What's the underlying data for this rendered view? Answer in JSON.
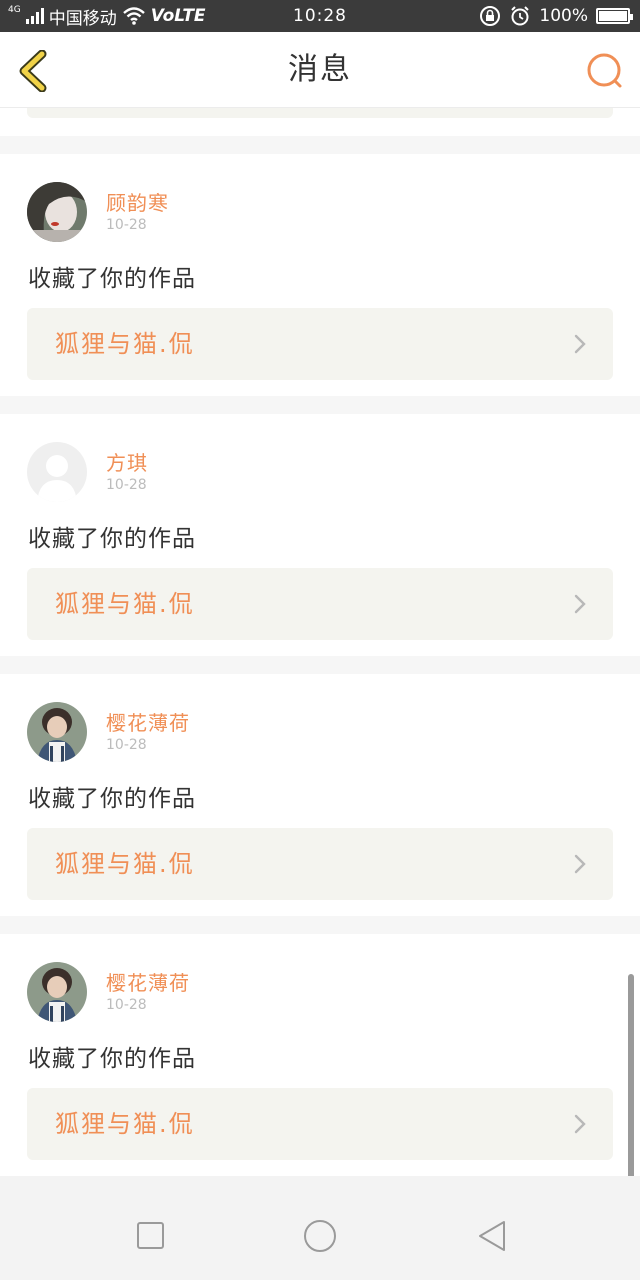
{
  "status_bar": {
    "network": "4G",
    "carrier": "中国移动",
    "volte": "VoLTE",
    "time": "10:28",
    "battery_percent": "100%"
  },
  "nav": {
    "title": "消息",
    "back_icon": "chevron-left-icon",
    "search_icon": "search-icon",
    "accent_color": "#f08f56",
    "back_color": "#f1d348"
  },
  "notifications": [
    {
      "username": "顾韵寒",
      "date": "10-28",
      "action": "收藏了你的作品",
      "work_title": "狐狸与猫.侃"
    },
    {
      "username": "方琪",
      "date": "10-28",
      "action": "收藏了你的作品",
      "work_title": "狐狸与猫.侃"
    },
    {
      "username": "樱花薄荷",
      "date": "10-28",
      "action": "收藏了你的作品",
      "work_title": "狐狸与猫.侃"
    },
    {
      "username": "樱花薄荷",
      "date": "10-28",
      "action": "收藏了你的作品",
      "work_title": "狐狸与猫.侃"
    }
  ],
  "system_nav": {
    "recent_icon": "square-icon",
    "home_icon": "circle-icon",
    "back_icon": "triangle-back-icon"
  }
}
